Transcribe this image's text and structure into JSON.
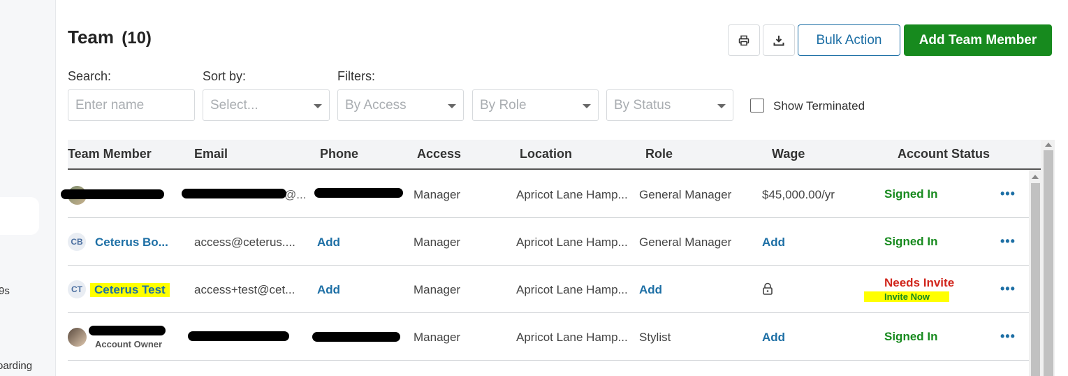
{
  "sidebar": {
    "fragment_1": "9s",
    "fragment_2": "oarding"
  },
  "header": {
    "title": "Team",
    "count": "(10)",
    "bulk_action_label": "Bulk Action",
    "add_member_label": "Add Team Member",
    "print_icon": "print-icon",
    "download_icon": "download-icon"
  },
  "filters": {
    "search_label": "Search:",
    "search_placeholder": "Enter name",
    "sort_label": "Sort by:",
    "sort_placeholder": "Select...",
    "filters_label": "Filters:",
    "access_placeholder": "By Access",
    "role_placeholder": "By Role",
    "status_placeholder": "By Status",
    "show_terminated_label": "Show Terminated"
  },
  "table": {
    "columns": [
      "Team Member",
      "Email",
      "Phone",
      "Access",
      "Location",
      "Role",
      "Wage",
      "Account Status"
    ],
    "rows": [
      {
        "email": "@...",
        "access": "Manager",
        "location": "Apricot Lane Hamp...",
        "role": "General Manager",
        "wage": "$45,000.00/yr",
        "status": "Signed In",
        "more": "•••"
      },
      {
        "initials": "CB",
        "name": "Ceterus Bo...",
        "email": "access@ceterus....",
        "phone": "Add",
        "access": "Manager",
        "location": "Apricot Lane Hamp...",
        "role": "General Manager",
        "wage": "Add",
        "status": "Signed In",
        "more": "•••"
      },
      {
        "initials": "CT",
        "name": "Ceterus Test",
        "email": "access+test@cet...",
        "phone": "Add",
        "access": "Manager",
        "location": "Apricot Lane Hamp...",
        "role": "Add",
        "wage_icon": "lock-icon",
        "status": "Needs Invite",
        "status_sub": "Invite Now",
        "more": "•••"
      },
      {
        "subtitle": "Account Owner",
        "access": "Manager",
        "location": "Apricot Lane Hamp...",
        "role": "Stylist",
        "wage": "Add",
        "status": "Signed In",
        "more": "•••"
      }
    ]
  },
  "colors": {
    "primary_green": "#178a1e",
    "link_blue": "#1d6fa5",
    "warn_red": "#d1261c",
    "highlight_yellow": "#ffff00"
  }
}
